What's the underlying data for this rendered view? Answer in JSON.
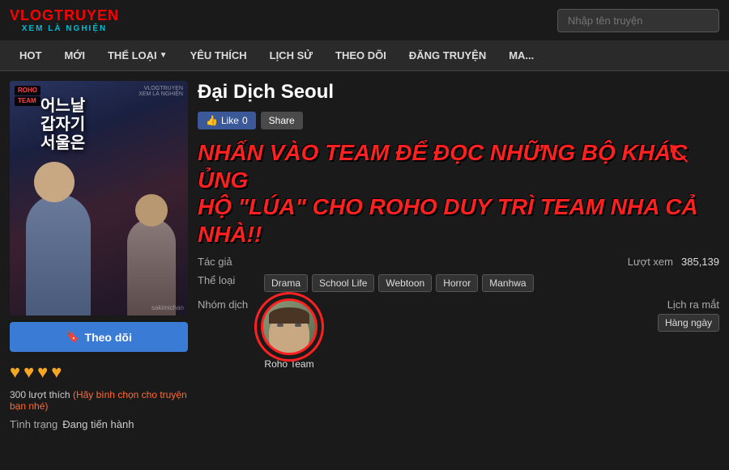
{
  "header": {
    "logo_top": "VLOGTRUYEN",
    "logo_bottom": "XEM LÀ NGHIỆN",
    "search_placeholder": "Nhập tên truyện"
  },
  "nav": {
    "items": [
      {
        "label": "HOT",
        "has_arrow": false
      },
      {
        "label": "MỚI",
        "has_arrow": false
      },
      {
        "label": "THỂ LOẠI",
        "has_arrow": true
      },
      {
        "label": "YÊU THÍCH",
        "has_arrow": false
      },
      {
        "label": "LỊCH SỬ",
        "has_arrow": false
      },
      {
        "label": "THEO DÕI",
        "has_arrow": false
      },
      {
        "label": "ĐĂNG TRUYỆN",
        "has_arrow": false
      },
      {
        "label": "MA...",
        "has_arrow": false
      }
    ]
  },
  "manga": {
    "title": "Đại Dịch Seoul",
    "cover_title_kr": "어느날갑자기서울은",
    "cover_roho": "ROHO\nTEAM",
    "like_count": "0",
    "like_label": "Like",
    "share_label": "Share",
    "overlay_line1": "NHẤN VÀO TEAM ĐỂ ĐỌC NHỮNG BỘ KHÁC ỦNG",
    "overlay_line2": "HỘ \"LÚA\" CHO ROHO DUY TRÌ TEAM NHA CẢ NHÀ!!",
    "tac_gia_label": "Tác giả",
    "tac_gia_value": "",
    "luot_xem_label": "Lượt xem",
    "luot_xem_value": "385,139",
    "the_loai_label": "Thể loại",
    "tags": [
      "Drama",
      "School Life",
      "Webtoon",
      "Horror",
      "Manhwa"
    ],
    "nhom_dich_label": "Nhóm dịch",
    "team_name": "Roho Team",
    "lich_ra_mat_label": "Lịch ra mắt",
    "lich_ra_mat_value": "Hàng ngày",
    "follow_label": "Theo dõi",
    "stars": [
      "♥",
      "♥",
      "♥",
      "♥"
    ],
    "likes_count": "300 lượt thích",
    "likes_vote": "(Hãy bình chọn cho truyện bạn nhé)",
    "tinh_trang_label": "Tình trạng",
    "tinh_trang_value": "Đang tiến hành"
  }
}
